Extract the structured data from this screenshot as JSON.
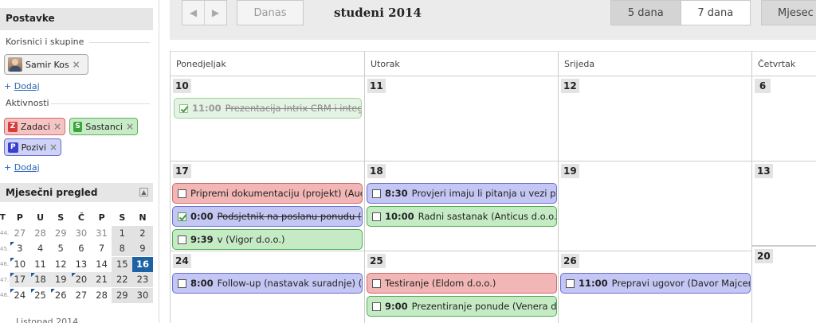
{
  "sidebar": {
    "header": "Postavke",
    "users_label": "Korisnici i skupine",
    "user_chip": "Samir Kos",
    "add_label": "Dodaj",
    "activities_label": "Aktivnosti",
    "activities": [
      {
        "label": "Zadaci",
        "letter": "Z",
        "color": "#d93b3b"
      },
      {
        "label": "Sastanci",
        "letter": "S",
        "color": "#3aa53a"
      },
      {
        "label": "Pozivi",
        "letter": "P",
        "color": "#3b3fd0"
      }
    ],
    "add_label_2": "Dodaj",
    "monthly_header": "Mjesečni pregled",
    "mini_cal": {
      "week_col_label": "T",
      "weekdays": [
        "P",
        "U",
        "S",
        "Č",
        "P",
        "S",
        "N"
      ],
      "weeks": [
        {
          "wk": "44.",
          "days": [
            "27",
            "28",
            "29",
            "30",
            "31",
            "1",
            "2"
          ]
        },
        {
          "wk": "45.",
          "days": [
            "3",
            "4",
            "5",
            "6",
            "7",
            "8",
            "9"
          ]
        },
        {
          "wk": "46.",
          "days": [
            "10",
            "11",
            "12",
            "13",
            "14",
            "15",
            "16"
          ]
        },
        {
          "wk": "47.",
          "days": [
            "17",
            "18",
            "19",
            "20",
            "21",
            "22",
            "23"
          ]
        },
        {
          "wk": "48.",
          "days": [
            "24",
            "25",
            "26",
            "27",
            "28",
            "29",
            "30"
          ]
        }
      ],
      "footer": "Listopad 2014"
    }
  },
  "toolbar": {
    "prev_icon": "◀",
    "next_icon": "▶",
    "today_label": "Danas",
    "title": "studeni 2014",
    "view_5": "5 dana",
    "view_7": "7 dana",
    "view_month": "Mjesec"
  },
  "calendar": {
    "columns": [
      "Ponedjeljak",
      "Utorak",
      "Srijeda",
      "Četvrtak"
    ],
    "week1": {
      "days": [
        "10",
        "11",
        "12",
        "6"
      ],
      "events": [
        {
          "time": "11:00",
          "text": "Prezentacija Intrix CRM i integr"
        }
      ]
    },
    "week2": {
      "days": [
        "17",
        "18",
        "19",
        "13"
      ],
      "mon_events": [
        {
          "time": "",
          "text": "Pripremi dokumentaciju (projekt) (Auc"
        },
        {
          "time": "0:00",
          "text": "Podsjetnik na poslanu ponudu ("
        },
        {
          "time": "9:39",
          "text": "v (Vigor d.o.o.)"
        }
      ],
      "tue_events": [
        {
          "time": "8:30",
          "text": "Provjeri imaju li pitanja u vezi pc"
        },
        {
          "time": "10:00",
          "text": "Radni sastanak (Anticus d.o.o."
        }
      ]
    },
    "week3": {
      "days": [
        "24",
        "25",
        "26",
        "20"
      ],
      "mon_events": [
        {
          "time": "8:00",
          "text": "Follow-up (nastavak suradnje) (S"
        }
      ],
      "tue_events": [
        {
          "time": "",
          "text": "Testiranje (Eldom d.o.o.)"
        },
        {
          "time": "9:00",
          "text": "Prezentiranje ponude (Venera d."
        }
      ],
      "wed_events": [
        {
          "time": "11:00",
          "text": "Prepravi ugovor (Davor Majcen"
        }
      ]
    }
  }
}
